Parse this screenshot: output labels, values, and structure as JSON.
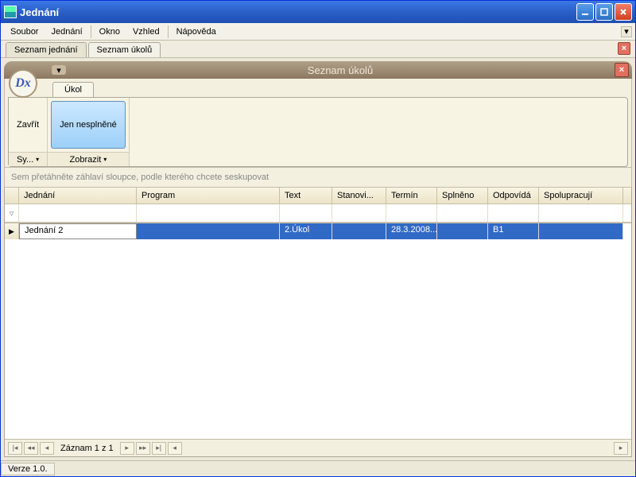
{
  "window": {
    "title": "Jednání"
  },
  "menubar": {
    "items": [
      "Soubor",
      "Jednání",
      "Okno",
      "Vzhled",
      "Nápověda"
    ]
  },
  "outer_tabs": {
    "items": [
      "Seznam jednání",
      "Seznam úkolů"
    ],
    "active": 1
  },
  "panel": {
    "badge": "Dx",
    "title": "Seznam úkolů"
  },
  "ribbon": {
    "tab": "Úkol",
    "groups": [
      {
        "button": "Zavřít",
        "label": "Sy...",
        "accent": false
      },
      {
        "button": "Jen nesplněné",
        "label": "Zobrazit",
        "accent": true
      }
    ]
  },
  "grouping_hint": "Sem přetáhněte záhlaví sloupce, podle kterého chcete seskupovat",
  "columns": {
    "jednani": "Jednání",
    "program": "Program",
    "text": "Text",
    "stanov": "Stanovi...",
    "termin": "Termín",
    "splneno": "Splněno",
    "odpovida": "Odpovídá",
    "spolu": "Spolupracují"
  },
  "rows": [
    {
      "jednani": "Jednání 2",
      "program": "",
      "text": "2.Úkol",
      "stanov": "",
      "termin": "28.3.2008...",
      "splneno": "",
      "odpovida": "B1",
      "spolu": ""
    }
  ],
  "navigator": {
    "text": "Záznam 1 z 1"
  },
  "status": {
    "version": "Verze 1.0."
  }
}
